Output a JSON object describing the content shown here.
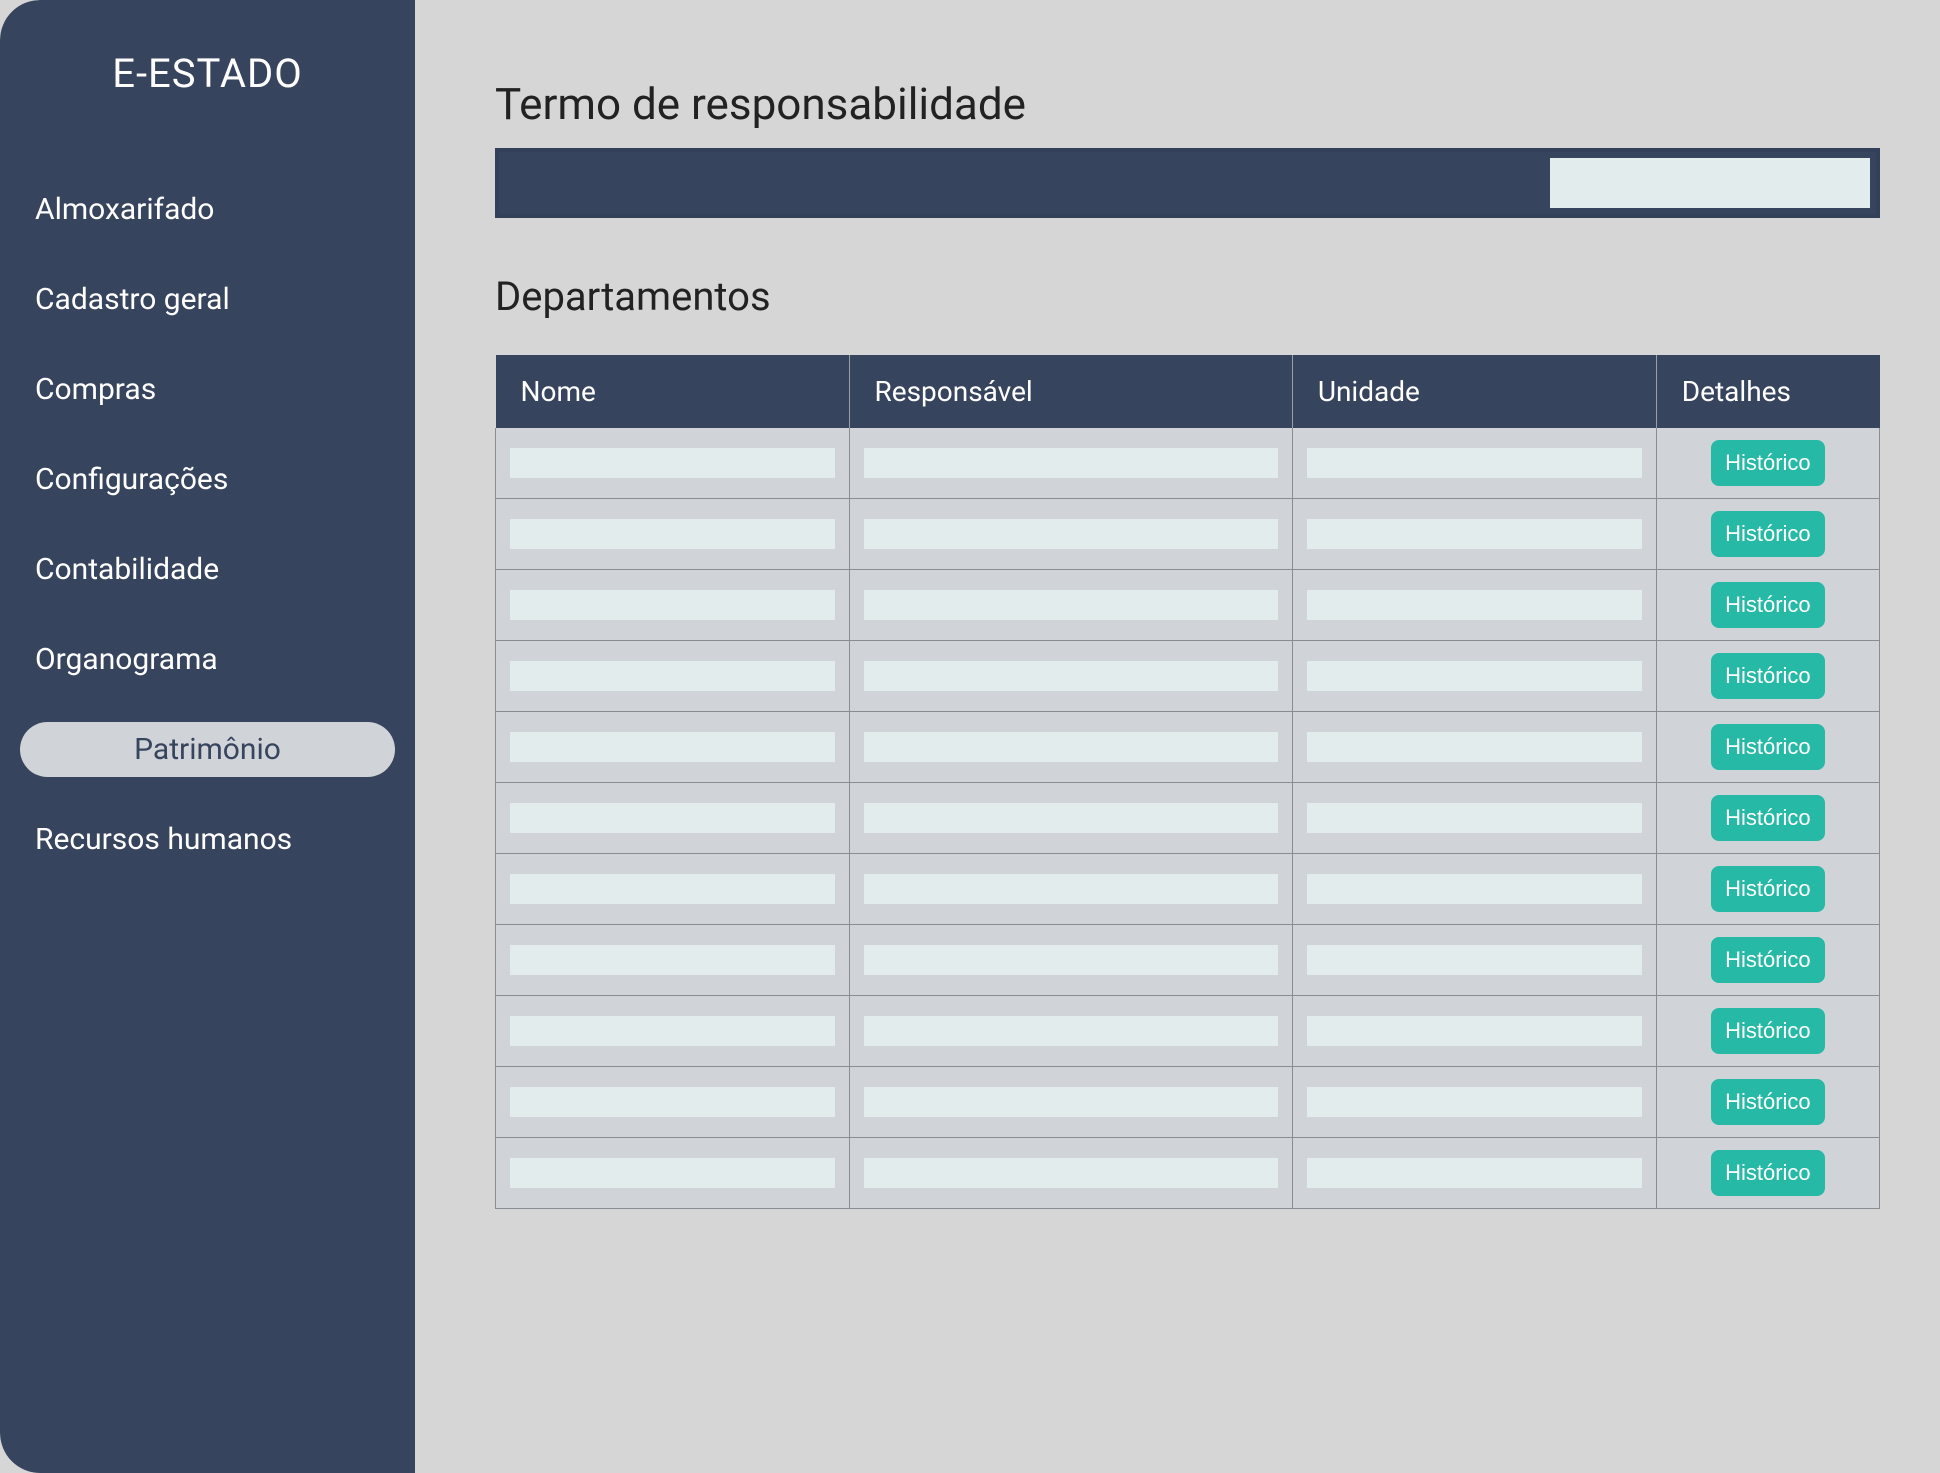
{
  "app": {
    "title": "E-ESTADO"
  },
  "sidebar": {
    "items": [
      {
        "label": "Almoxarifado",
        "active": false
      },
      {
        "label": "Cadastro geral",
        "active": false
      },
      {
        "label": "Compras",
        "active": false
      },
      {
        "label": "Configurações",
        "active": false
      },
      {
        "label": "Contabilidade",
        "active": false
      },
      {
        "label": "Organograma",
        "active": false
      },
      {
        "label": "Patrimônio",
        "active": true
      },
      {
        "label": "Recursos humanos",
        "active": false
      }
    ]
  },
  "main": {
    "title": "Termo de responsabilidade",
    "search_value": "",
    "section_title": "Departamentos",
    "table": {
      "columns": [
        "Nome",
        "Responsável",
        "Unidade",
        "Detalhes"
      ],
      "action_label": "Histórico",
      "rows": [
        {
          "nome": "",
          "responsavel": "",
          "unidade": ""
        },
        {
          "nome": "",
          "responsavel": "",
          "unidade": ""
        },
        {
          "nome": "",
          "responsavel": "",
          "unidade": ""
        },
        {
          "nome": "",
          "responsavel": "",
          "unidade": ""
        },
        {
          "nome": "",
          "responsavel": "",
          "unidade": ""
        },
        {
          "nome": "",
          "responsavel": "",
          "unidade": ""
        },
        {
          "nome": "",
          "responsavel": "",
          "unidade": ""
        },
        {
          "nome": "",
          "responsavel": "",
          "unidade": ""
        },
        {
          "nome": "",
          "responsavel": "",
          "unidade": ""
        },
        {
          "nome": "",
          "responsavel": "",
          "unidade": ""
        },
        {
          "nome": "",
          "responsavel": "",
          "unidade": ""
        }
      ]
    }
  },
  "colors": {
    "sidebar_bg": "#37445e",
    "page_bg": "#d6d6d6",
    "cell_bg": "#d0d3d8",
    "placeholder_bg": "#e3eced",
    "accent": "#26b9a5"
  }
}
